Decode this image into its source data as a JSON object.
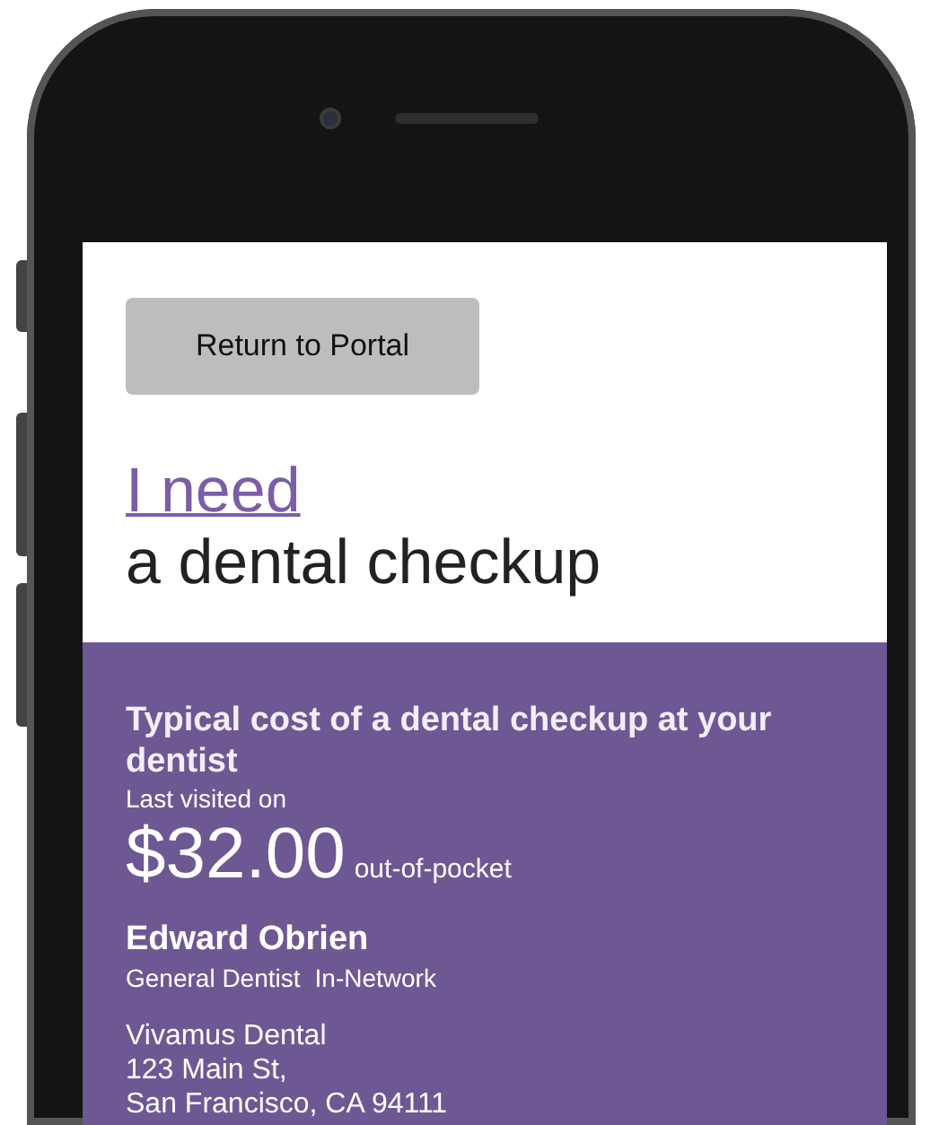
{
  "return_button": {
    "label": "Return to Portal"
  },
  "heading": {
    "link": "I need",
    "text": "a dental checkup"
  },
  "cost_card": {
    "title": "Typical cost of a dental checkup at your dentist",
    "last_visited": "Last visited on",
    "price": "$32.00",
    "price_note": "out-of-pocket",
    "dentist": {
      "name": "Edward Obrien",
      "specialty": "General Dentist",
      "network": "In-Network"
    },
    "practice": {
      "name": "Vivamus Dental",
      "address": [
        "123 Main St,",
        "San Francisco, CA  94111"
      ]
    }
  }
}
